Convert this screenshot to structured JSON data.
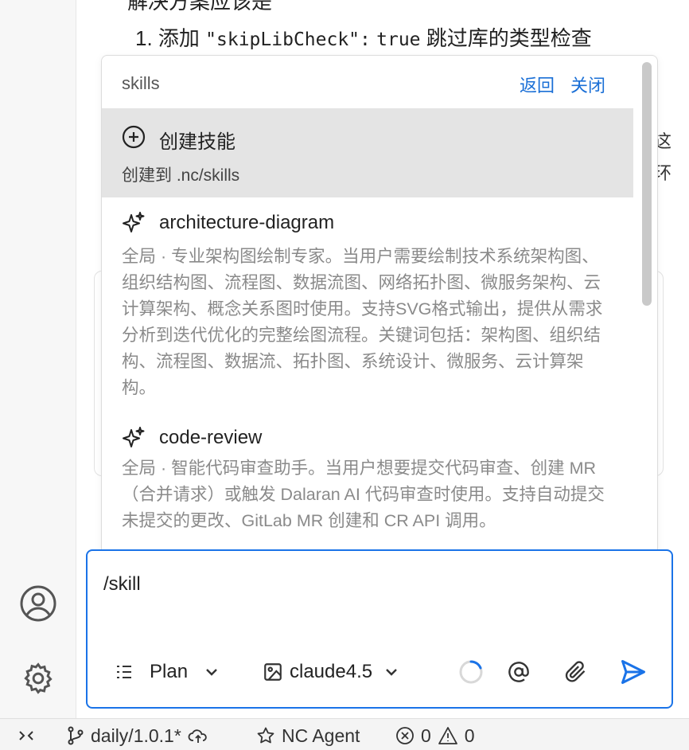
{
  "background": {
    "partial_heading": "解决方案应该是",
    "step_number": "1.",
    "step_text_prefix": "添加",
    "step_code_key": "\"skipLibCheck\":",
    "step_code_val": "true",
    "step_text_suffix": "跳过库的类型检查",
    "right_edge_chars": [
      "这",
      "环"
    ]
  },
  "popup": {
    "title": "skills",
    "back_label": "返回",
    "close_label": "关闭",
    "create": {
      "icon": "plus-circle-icon",
      "title": "创建技能",
      "subtitle": "创建到 .nc/skills"
    },
    "skills": [
      {
        "icon": "sparkles-icon",
        "name": "architecture-diagram",
        "description": "全局 · 专业架构图绘制专家。当用户需要绘制技术系统架构图、组织结构图、流程图、数据流图、网络拓扑图、微服务架构、云计算架构、概念关系图时使用。支持SVG格式输出，提供从需求分析到迭代优化的完整绘图流程。关键词包括：架构图、组织结构、流程图、数据流、拓扑图、系统设计、微服务、云计算架构。"
      },
      {
        "icon": "sparkles-icon",
        "name": "code-review",
        "description": "全局 · 智能代码审查助手。当用户想要提交代码审查、创建 MR（合并请求）或触发 Dalaran AI 代码审查时使用。支持自动提交未提交的更改、GitLab MR 创建和 CR API 调用。"
      }
    ]
  },
  "input": {
    "value": "/skill",
    "mode_label": "Plan",
    "model_label": "claude4.5"
  },
  "statusbar": {
    "branch": "daily/1.0.1*",
    "agent": "NC Agent",
    "errors": "0",
    "warnings": "0"
  },
  "colors": {
    "accent": "#1a73e8",
    "link": "#1a6fd6",
    "selected_bg": "#e4e4e4"
  }
}
